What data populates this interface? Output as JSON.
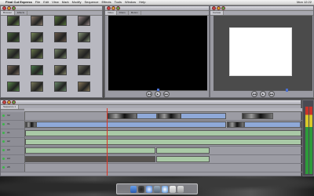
{
  "menubar": {
    "apple": "",
    "app": "Final Cut Express",
    "items": [
      "File",
      "Edit",
      "View",
      "Mark",
      "Modify",
      "Sequence",
      "Effects",
      "Tools",
      "Window",
      "Help"
    ],
    "clock": "Mon 12:22"
  },
  "browser": {
    "tabs": [
      "Browser",
      "Effects"
    ],
    "clips": [
      {
        "name": "",
        "color": "#6a8a4a"
      },
      {
        "name": "",
        "color": "#8a7a6a"
      },
      {
        "name": "",
        "color": "#5a7a3a"
      },
      {
        "name": "",
        "color": "#9a8a8a"
      },
      {
        "name": "",
        "color": "#4a6a3a"
      },
      {
        "name": "",
        "color": "#7a8a5a"
      },
      {
        "name": "",
        "color": "#6a5a4a"
      },
      {
        "name": "",
        "color": "#8a9a7a"
      },
      {
        "name": "",
        "color": "#5a6a4a"
      },
      {
        "name": "",
        "color": "#6a7a4a"
      },
      {
        "name": "",
        "color": "#7a8a6a"
      },
      {
        "name": "",
        "color": "#5a5a4a"
      },
      {
        "name": "",
        "color": "#7a6a5a"
      },
      {
        "name": "",
        "color": "#4a7a4a"
      },
      {
        "name": "",
        "color": "#8a8a6a"
      },
      {
        "name": "",
        "color": "#6a6a5a"
      },
      {
        "name": "",
        "color": "#5a8a4a"
      },
      {
        "name": "",
        "color": "#7a7a5a"
      },
      {
        "name": "",
        "color": "#6a8a6a"
      },
      {
        "name": "",
        "color": "#8a7a5a"
      }
    ]
  },
  "viewer": {
    "tabs": [
      "Video",
      "Filters",
      "Motion"
    ]
  },
  "canvas": {
    "tabs": [
      "Canvas"
    ]
  },
  "timeline": {
    "tabs": [
      "Sequence 1"
    ],
    "tracks": [
      {
        "label": "V2"
      },
      {
        "label": "V1"
      },
      {
        "label": "A1"
      },
      {
        "label": "A2"
      },
      {
        "label": "A3"
      },
      {
        "label": "A4"
      },
      {
        "label": "A5"
      }
    ]
  },
  "colors": {
    "accent": "#4a6fd0",
    "video_clip": "#8fa9d8",
    "audio_clip": "#a9c9a6"
  },
  "icons": [
    "apple-icon",
    "play-icon",
    "rewind-icon",
    "fast-forward-icon",
    "finder-icon",
    "dashboard-icon",
    "safari-icon",
    "mail-icon",
    "itunes-icon",
    "trash-icon"
  ]
}
